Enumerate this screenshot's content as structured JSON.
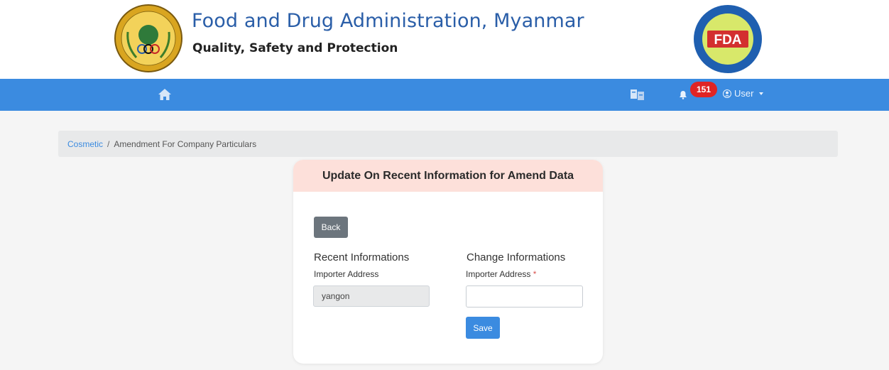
{
  "header": {
    "title": "Food and Drug Administration, Myanmar",
    "subtitle": "Quality, Safety and Protection",
    "logo_right_text": "FDA"
  },
  "navbar": {
    "home_icon": "home-icon",
    "lang_icon": "language-icon",
    "bell_icon": "bell-icon",
    "notification_count": "151",
    "user_label": "User",
    "colors": {
      "bar": "#3b8be0",
      "badge": "#e02424"
    }
  },
  "breadcrumb": {
    "link": "Cosmetic",
    "separator": "/",
    "current": "Amendment For Company Particulars"
  },
  "card": {
    "title": "Update On Recent Information for Amend Data",
    "back_label": "Back",
    "recent": {
      "heading": "Recent Informations",
      "label": "Importer Address",
      "value": "yangon"
    },
    "change": {
      "heading": "Change Informations",
      "label": "Importer Address",
      "required_mark": "*",
      "value": ""
    },
    "save_label": "Save"
  }
}
